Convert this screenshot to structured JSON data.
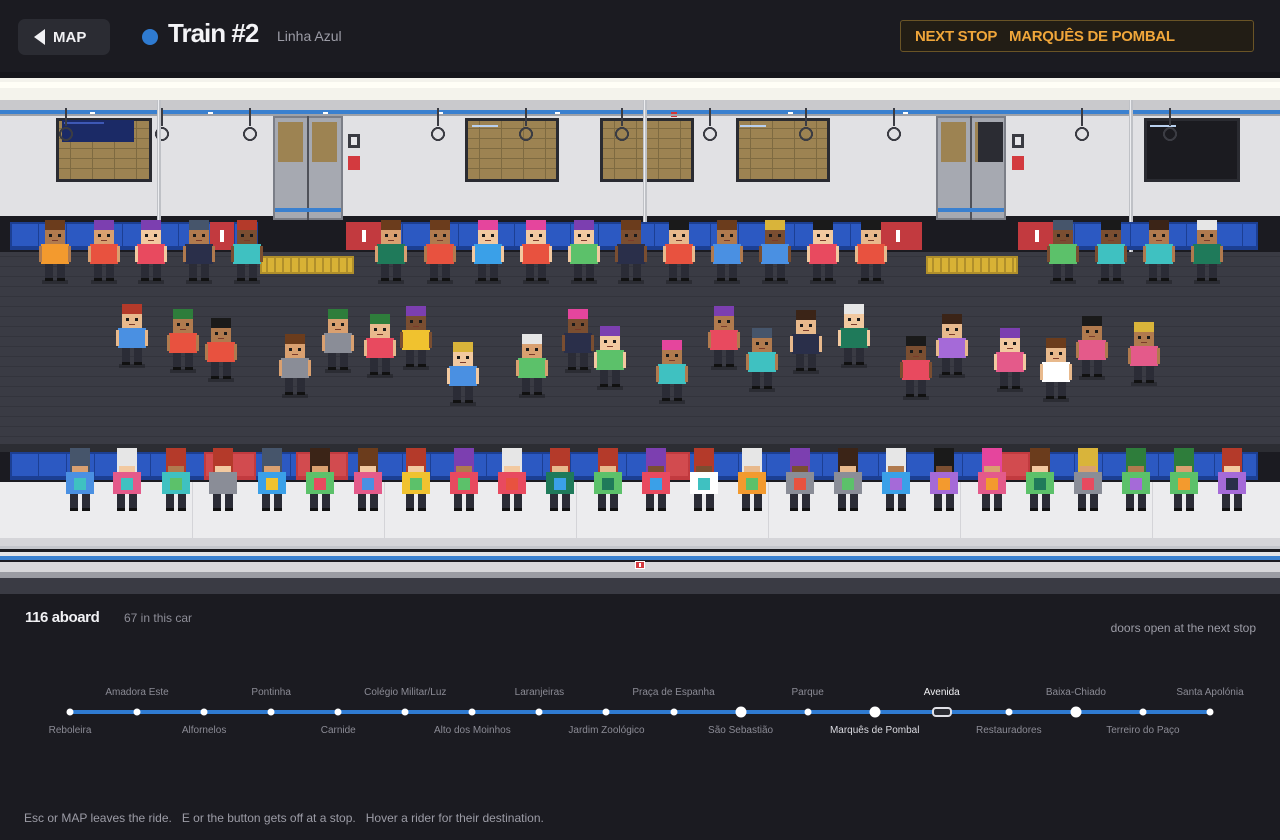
{
  "header": {
    "map_label": "MAP",
    "train_title": "Train #2",
    "line_name": "Linha Azul",
    "line_color": "#2f7bd1",
    "next_stop_label": "NEXT STOP",
    "next_stop_name": "MARQUÊS DE POMBAL"
  },
  "status": {
    "aboard": "116 aboard",
    "in_car": "67 in this car",
    "doors": "doors open at the next stop"
  },
  "route": {
    "stops": [
      {
        "name": "Reboleira",
        "pos": "bottom"
      },
      {
        "name": "Amadora Este",
        "pos": "top"
      },
      {
        "name": "Alfornelos",
        "pos": "bottom"
      },
      {
        "name": "Pontinha",
        "pos": "top"
      },
      {
        "name": "Carnide",
        "pos": "bottom"
      },
      {
        "name": "Colégio Militar/Luz",
        "pos": "top"
      },
      {
        "name": "Alto dos Moinhos",
        "pos": "bottom"
      },
      {
        "name": "Laranjeiras",
        "pos": "top"
      },
      {
        "name": "Jardim Zoológico",
        "pos": "bottom"
      },
      {
        "name": "Praça de Espanha",
        "pos": "top"
      },
      {
        "name": "São Sebastião",
        "pos": "bottom"
      },
      {
        "name": "Parque",
        "pos": "top"
      },
      {
        "name": "Marquês de Pombal",
        "pos": "bottom"
      },
      {
        "name": "Avenida",
        "pos": "top"
      },
      {
        "name": "Restauradores",
        "pos": "bottom"
      },
      {
        "name": "Baixa-Chiado",
        "pos": "top"
      },
      {
        "name": "Terreiro do Paço",
        "pos": "bottom"
      },
      {
        "name": "Santa Apolónia",
        "pos": "top"
      }
    ],
    "interchange_stops": [
      "São Sebastião",
      "Marquês de Pombal",
      "Baixa-Chiado"
    ],
    "current_stop": "Avenida",
    "next_stop": "Marquês de Pombal"
  },
  "hint": "Esc or MAP leaves the ride.   E or the button gets off at a stop.   Hover a rider for their destination."
}
